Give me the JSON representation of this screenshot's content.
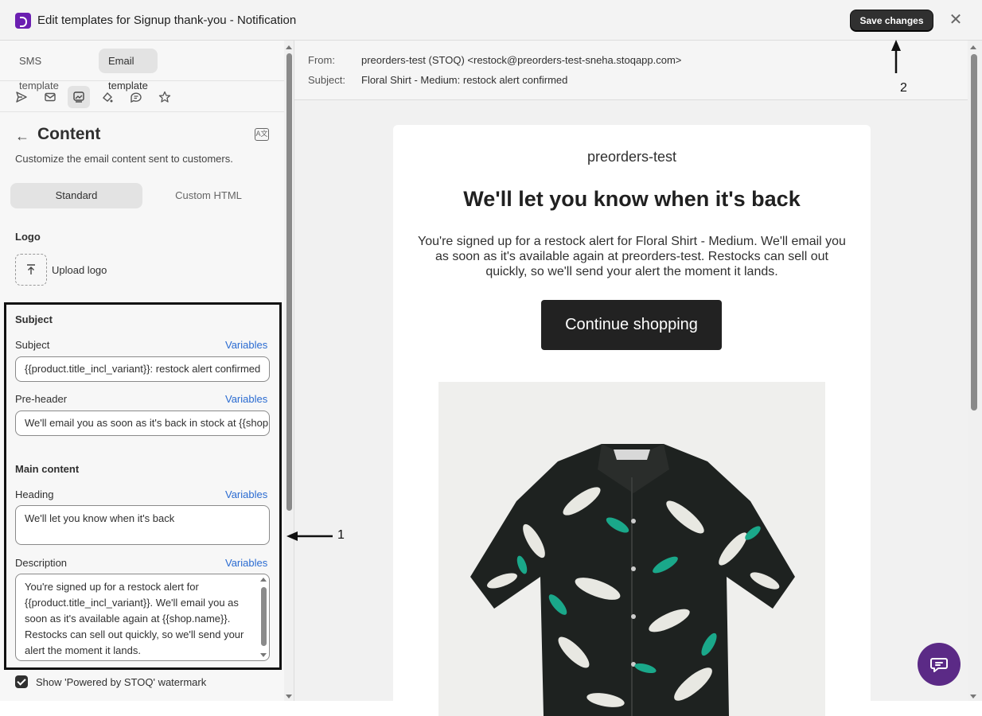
{
  "window": {
    "title": "Edit templates for Signup thank-you - Notification",
    "save_label": "Save changes",
    "close_symbol": "✕"
  },
  "left": {
    "tabs": [
      {
        "label": "SMS template"
      },
      {
        "label": "Email template"
      }
    ],
    "toolbar_icons": [
      "send-icon",
      "mail-icon",
      "image-content-icon",
      "paint-icon",
      "chat-bubble-icon",
      "star-icon"
    ],
    "content_title": "Content",
    "content_desc": "Customize the email content sent to customers.",
    "segments": {
      "standard": "Standard",
      "custom": "Custom HTML"
    },
    "logo": {
      "label": "Logo",
      "upload_label": "Upload logo"
    },
    "subject_section": "Subject",
    "subject": {
      "label": "Subject",
      "variables": "Variables",
      "value": "{{product.title_incl_variant}}: restock alert confirmed"
    },
    "preheader": {
      "label": "Pre-header",
      "variables": "Variables",
      "value": "We'll email you as soon as it's back in stock at {{shop.name}}"
    },
    "main_section": "Main content",
    "heading": {
      "label": "Heading",
      "variables": "Variables",
      "value": "We'll let you know when it's back"
    },
    "description": {
      "label": "Description",
      "variables": "Variables",
      "value": "You're signed up for a restock alert for {{product.title_incl_variant}}. We'll email you as soon as it's available again at {{shop.name}}. Restocks can sell out quickly, so we'll send your alert the moment it lands."
    },
    "watermark": {
      "label": "Show 'Powered by STOQ' watermark",
      "checked": true
    }
  },
  "preview": {
    "from_label": "From:",
    "from_value": "preorders-test (STOQ) <restock@preorders-test-sneha.stoqapp.com>",
    "subject_label": "Subject:",
    "subject_value": "Floral Shirt - Medium: restock alert confirmed",
    "shop_name": "preorders-test",
    "heading": "We'll let you know when it's back",
    "body": "You're signed up for a restock alert for Floral Shirt - Medium. We'll email you as soon as it's available again at preorders-test. Restocks can sell out quickly, so we'll send your alert the moment it lands.",
    "cta": "Continue shopping"
  },
  "annotations": {
    "one": "1",
    "two": "2"
  },
  "colors": {
    "accent": "#303030",
    "link": "#2a6bd1",
    "brand": "#6b1fb1",
    "chat": "#5b2a86"
  }
}
